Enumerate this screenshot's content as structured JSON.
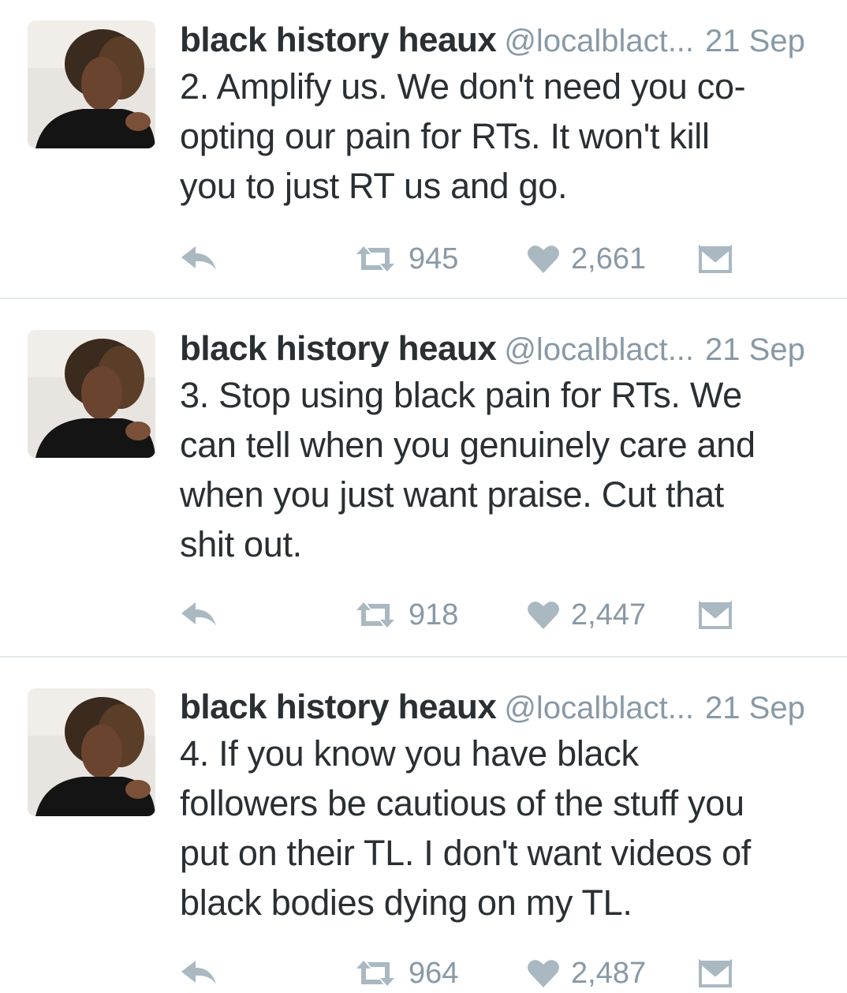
{
  "tweets": [
    {
      "name": "black history heaux",
      "handle": "@localblact...",
      "time": "21 Sep",
      "lines": [
        "2. Amplify us. We don't need you co-",
        "opting our pain for RTs. It won't kill",
        "you to just RT us and go."
      ],
      "retweets": "945",
      "likes": "2,661"
    },
    {
      "name": "black history heaux",
      "handle": "@localblact...",
      "time": "21 Sep",
      "lines": [
        "3. Stop using black pain for RTs. We",
        "can tell when you genuinely care and",
        "when you just want praise. Cut that",
        "shit out."
      ],
      "retweets": "918",
      "likes": "2,447"
    },
    {
      "name": "black history heaux",
      "handle": "@localblact...",
      "time": "21 Sep",
      "lines": [
        "4. If you know you have black",
        "followers be cautious of the stuff you",
        "put on their TL. I don't want videos of",
        "black bodies dying on my TL."
      ],
      "retweets": "964",
      "likes": "2,487"
    }
  ],
  "icons": {
    "reply": "reply-icon",
    "retweet": "retweet-icon",
    "like": "heart-icon",
    "dm": "envelope-icon"
  },
  "colors": {
    "name": "#292f33",
    "meta": "#8899a6",
    "divider": "#e1e8ed",
    "icon": "#aab8c2"
  }
}
